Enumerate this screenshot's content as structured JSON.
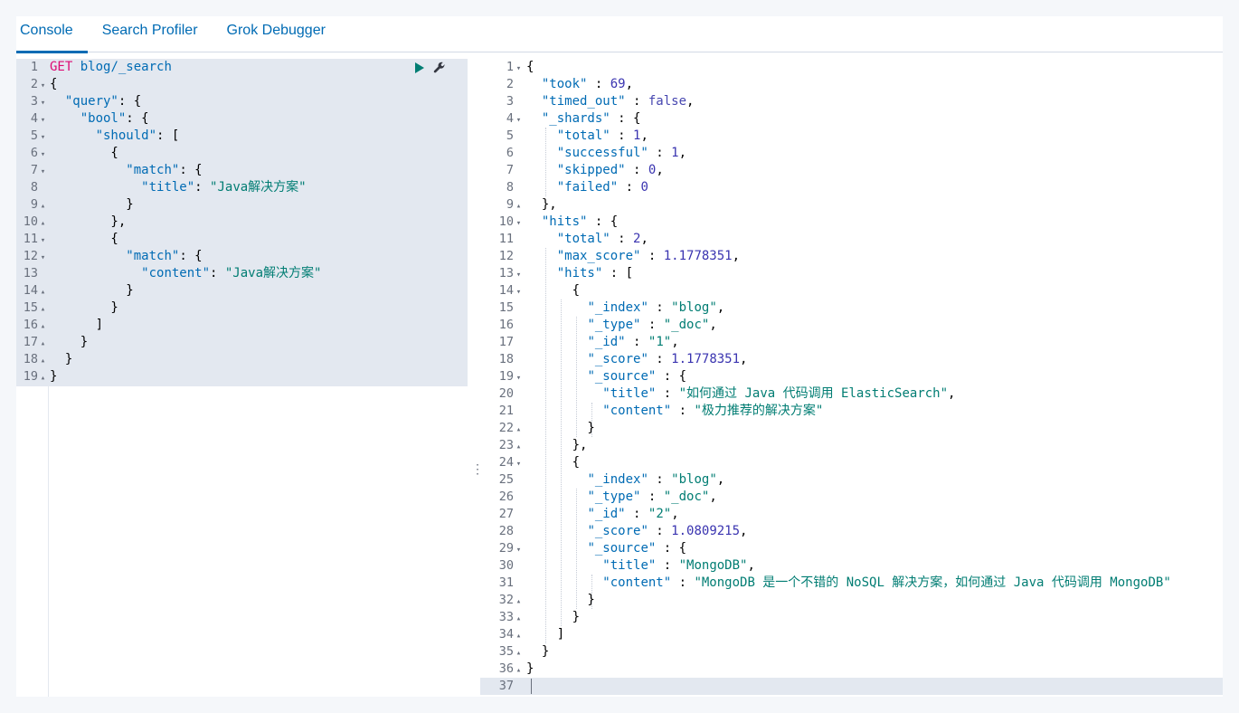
{
  "tabs": [
    {
      "label": "Console",
      "active": true
    },
    {
      "label": "Search Profiler",
      "active": false
    },
    {
      "label": "Grok Debugger",
      "active": false
    }
  ],
  "request": {
    "method": "GET",
    "path": "blog/_search",
    "lines": [
      {
        "n": "1",
        "fold": "",
        "html": "<span class=\"m\" data-name=\"request-method\">GET</span> <span class=\"u\" data-name=\"request-path\">blog/_search</span>"
      },
      {
        "n": "2",
        "fold": "▾",
        "text": "{"
      },
      {
        "n": "3",
        "fold": "▾",
        "parts": [
          [
            "  ",
            ""
          ],
          [
            "\"query\"",
            "k"
          ],
          [
            ": {",
            ""
          ]
        ]
      },
      {
        "n": "4",
        "fold": "▾",
        "parts": [
          [
            "    ",
            ""
          ],
          [
            "\"bool\"",
            "k"
          ],
          [
            ": {",
            ""
          ]
        ]
      },
      {
        "n": "5",
        "fold": "▾",
        "parts": [
          [
            "      ",
            ""
          ],
          [
            "\"should\"",
            "k"
          ],
          [
            ": [",
            ""
          ]
        ]
      },
      {
        "n": "6",
        "fold": "▾",
        "text": "        {"
      },
      {
        "n": "7",
        "fold": "▾",
        "parts": [
          [
            "          ",
            ""
          ],
          [
            "\"match\"",
            "k"
          ],
          [
            ": {",
            ""
          ]
        ]
      },
      {
        "n": "8",
        "fold": "",
        "parts": [
          [
            "            ",
            ""
          ],
          [
            "\"title\"",
            "k"
          ],
          [
            ": ",
            ""
          ],
          [
            "\"Java解决方案\"",
            "s"
          ]
        ]
      },
      {
        "n": "9",
        "fold": "▴",
        "text": "          }"
      },
      {
        "n": "10",
        "fold": "▴",
        "text": "        },"
      },
      {
        "n": "11",
        "fold": "▾",
        "text": "        {"
      },
      {
        "n": "12",
        "fold": "▾",
        "parts": [
          [
            "          ",
            ""
          ],
          [
            "\"match\"",
            "k"
          ],
          [
            ": {",
            ""
          ]
        ]
      },
      {
        "n": "13",
        "fold": "",
        "parts": [
          [
            "            ",
            ""
          ],
          [
            "\"content\"",
            "k"
          ],
          [
            ": ",
            ""
          ],
          [
            "\"Java解决方案\"",
            "s"
          ]
        ]
      },
      {
        "n": "14",
        "fold": "▴",
        "text": "          }"
      },
      {
        "n": "15",
        "fold": "▴",
        "text": "        }"
      },
      {
        "n": "16",
        "fold": "▴",
        "text": "      ]"
      },
      {
        "n": "17",
        "fold": "▴",
        "text": "    }"
      },
      {
        "n": "18",
        "fold": "▴",
        "text": "  }"
      },
      {
        "n": "19",
        "fold": "▴",
        "text": "}"
      }
    ]
  },
  "response": {
    "lines": [
      {
        "n": "1",
        "fold": "▾",
        "text": "{"
      },
      {
        "n": "2",
        "fold": "",
        "parts": [
          [
            "  ",
            ""
          ],
          [
            "\"took\"",
            "k"
          ],
          [
            " : ",
            ""
          ],
          [
            "69",
            "n"
          ],
          [
            ",",
            ""
          ]
        ]
      },
      {
        "n": "3",
        "fold": "",
        "parts": [
          [
            "  ",
            ""
          ],
          [
            "\"timed_out\"",
            "k"
          ],
          [
            " : ",
            ""
          ],
          [
            "false",
            "b"
          ],
          [
            ",",
            ""
          ]
        ]
      },
      {
        "n": "4",
        "fold": "▾",
        "parts": [
          [
            "  ",
            ""
          ],
          [
            "\"_shards\"",
            "k"
          ],
          [
            " : {",
            ""
          ]
        ]
      },
      {
        "n": "5",
        "fold": "",
        "parts": [
          [
            "    ",
            ""
          ],
          [
            "\"total\"",
            "k"
          ],
          [
            " : ",
            ""
          ],
          [
            "1",
            "n"
          ],
          [
            ",",
            ""
          ]
        ]
      },
      {
        "n": "6",
        "fold": "",
        "parts": [
          [
            "    ",
            ""
          ],
          [
            "\"successful\"",
            "k"
          ],
          [
            " : ",
            ""
          ],
          [
            "1",
            "n"
          ],
          [
            ",",
            ""
          ]
        ]
      },
      {
        "n": "7",
        "fold": "",
        "parts": [
          [
            "    ",
            ""
          ],
          [
            "\"skipped\"",
            "k"
          ],
          [
            " : ",
            ""
          ],
          [
            "0",
            "n"
          ],
          [
            ",",
            ""
          ]
        ]
      },
      {
        "n": "8",
        "fold": "",
        "parts": [
          [
            "    ",
            ""
          ],
          [
            "\"failed\"",
            "k"
          ],
          [
            " : ",
            ""
          ],
          [
            "0",
            "n"
          ]
        ]
      },
      {
        "n": "9",
        "fold": "▴",
        "text": "  },"
      },
      {
        "n": "10",
        "fold": "▾",
        "parts": [
          [
            "  ",
            ""
          ],
          [
            "\"hits\"",
            "k"
          ],
          [
            " : {",
            ""
          ]
        ]
      },
      {
        "n": "11",
        "fold": "",
        "parts": [
          [
            "    ",
            ""
          ],
          [
            "\"total\"",
            "k"
          ],
          [
            " : ",
            ""
          ],
          [
            "2",
            "n"
          ],
          [
            ",",
            ""
          ]
        ]
      },
      {
        "n": "12",
        "fold": "",
        "parts": [
          [
            "    ",
            ""
          ],
          [
            "\"max_score\"",
            "k"
          ],
          [
            " : ",
            ""
          ],
          [
            "1.1778351",
            "n"
          ],
          [
            ",",
            ""
          ]
        ]
      },
      {
        "n": "13",
        "fold": "▾",
        "parts": [
          [
            "    ",
            ""
          ],
          [
            "\"hits\"",
            "k"
          ],
          [
            " : [",
            ""
          ]
        ]
      },
      {
        "n": "14",
        "fold": "▾",
        "text": "      {"
      },
      {
        "n": "15",
        "fold": "",
        "parts": [
          [
            "        ",
            ""
          ],
          [
            "\"_index\"",
            "k"
          ],
          [
            " : ",
            ""
          ],
          [
            "\"blog\"",
            "s"
          ],
          [
            ",",
            ""
          ]
        ]
      },
      {
        "n": "16",
        "fold": "",
        "parts": [
          [
            "        ",
            ""
          ],
          [
            "\"_type\"",
            "k"
          ],
          [
            " : ",
            ""
          ],
          [
            "\"_doc\"",
            "s"
          ],
          [
            ",",
            ""
          ]
        ]
      },
      {
        "n": "17",
        "fold": "",
        "parts": [
          [
            "        ",
            ""
          ],
          [
            "\"_id\"",
            "k"
          ],
          [
            " : ",
            ""
          ],
          [
            "\"1\"",
            "s"
          ],
          [
            ",",
            ""
          ]
        ]
      },
      {
        "n": "18",
        "fold": "",
        "parts": [
          [
            "        ",
            ""
          ],
          [
            "\"_score\"",
            "k"
          ],
          [
            " : ",
            ""
          ],
          [
            "1.1778351",
            "n"
          ],
          [
            ",",
            ""
          ]
        ]
      },
      {
        "n": "19",
        "fold": "▾",
        "parts": [
          [
            "        ",
            ""
          ],
          [
            "\"_source\"",
            "k"
          ],
          [
            " : {",
            ""
          ]
        ]
      },
      {
        "n": "20",
        "fold": "",
        "parts": [
          [
            "          ",
            ""
          ],
          [
            "\"title\"",
            "k"
          ],
          [
            " : ",
            ""
          ],
          [
            "\"如何通过 Java 代码调用 ElasticSearch\"",
            "s"
          ],
          [
            ",",
            ""
          ]
        ]
      },
      {
        "n": "21",
        "fold": "",
        "parts": [
          [
            "          ",
            ""
          ],
          [
            "\"content\"",
            "k"
          ],
          [
            " : ",
            ""
          ],
          [
            "\"极力推荐的解决方案\"",
            "s"
          ]
        ]
      },
      {
        "n": "22",
        "fold": "▴",
        "text": "        }"
      },
      {
        "n": "23",
        "fold": "▴",
        "text": "      },"
      },
      {
        "n": "24",
        "fold": "▾",
        "text": "      {"
      },
      {
        "n": "25",
        "fold": "",
        "parts": [
          [
            "        ",
            ""
          ],
          [
            "\"_index\"",
            "k"
          ],
          [
            " : ",
            ""
          ],
          [
            "\"blog\"",
            "s"
          ],
          [
            ",",
            ""
          ]
        ]
      },
      {
        "n": "26",
        "fold": "",
        "parts": [
          [
            "        ",
            ""
          ],
          [
            "\"_type\"",
            "k"
          ],
          [
            " : ",
            ""
          ],
          [
            "\"_doc\"",
            "s"
          ],
          [
            ",",
            ""
          ]
        ]
      },
      {
        "n": "27",
        "fold": "",
        "parts": [
          [
            "        ",
            ""
          ],
          [
            "\"_id\"",
            "k"
          ],
          [
            " : ",
            ""
          ],
          [
            "\"2\"",
            "s"
          ],
          [
            ",",
            ""
          ]
        ]
      },
      {
        "n": "28",
        "fold": "",
        "parts": [
          [
            "        ",
            ""
          ],
          [
            "\"_score\"",
            "k"
          ],
          [
            " : ",
            ""
          ],
          [
            "1.0809215",
            "n"
          ],
          [
            ",",
            ""
          ]
        ]
      },
      {
        "n": "29",
        "fold": "▾",
        "parts": [
          [
            "        ",
            ""
          ],
          [
            "\"_source\"",
            "k"
          ],
          [
            " : {",
            ""
          ]
        ]
      },
      {
        "n": "30",
        "fold": "",
        "parts": [
          [
            "          ",
            ""
          ],
          [
            "\"title\"",
            "k"
          ],
          [
            " : ",
            ""
          ],
          [
            "\"MongoDB\"",
            "s"
          ],
          [
            ",",
            ""
          ]
        ]
      },
      {
        "n": "31",
        "fold": "",
        "parts": [
          [
            "          ",
            ""
          ],
          [
            "\"content\"",
            "k"
          ],
          [
            " : ",
            ""
          ],
          [
            "\"MongoDB 是一个不错的 NoSQL 解决方案，如何通过 Java 代码调用 MongoDB\"",
            "s"
          ]
        ]
      },
      {
        "n": "32",
        "fold": "▴",
        "text": "        }"
      },
      {
        "n": "33",
        "fold": "▴",
        "text": "      }"
      },
      {
        "n": "34",
        "fold": "▴",
        "text": "    ]"
      },
      {
        "n": "35",
        "fold": "▴",
        "text": "  }"
      },
      {
        "n": "36",
        "fold": "▴",
        "text": "}"
      },
      {
        "n": "37",
        "fold": "",
        "text": ""
      }
    ]
  },
  "icons": {
    "run": "play-icon",
    "settings": "wrench-icon",
    "resize": "vertical-ellipsis-icon"
  },
  "colors": {
    "key": "#006bb4",
    "string": "#017d73",
    "number": "#3a34b0",
    "method": "#dd0a73"
  }
}
